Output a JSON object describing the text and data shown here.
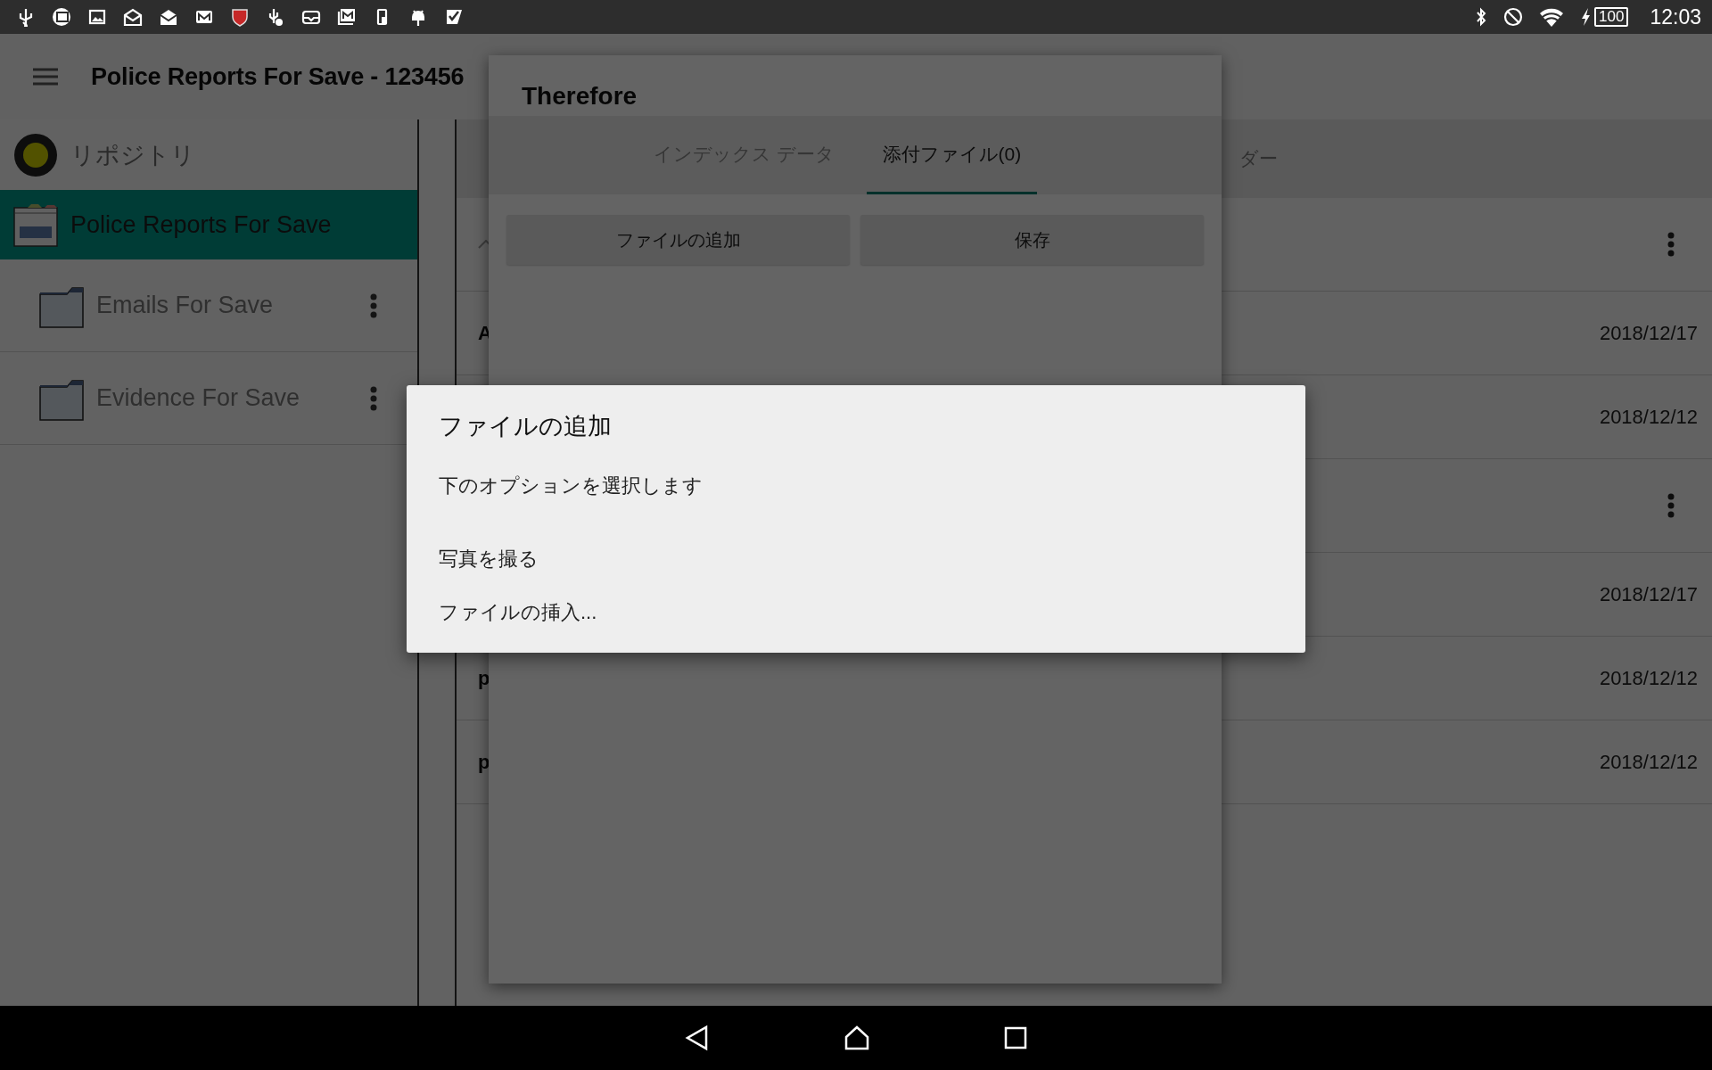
{
  "status_bar": {
    "battery": "100",
    "time": "12:03"
  },
  "app_bar": {
    "title": "Police Reports For Save - 123456"
  },
  "sidebar": {
    "repository": "リポジトリ",
    "items": [
      {
        "label": "Police Reports For Save",
        "selected": true,
        "kind": "cabinet"
      },
      {
        "label": "Emails For Save",
        "selected": false,
        "kind": "folder"
      },
      {
        "label": "Evidence For Save",
        "selected": false,
        "kind": "folder"
      }
    ]
  },
  "main": {
    "tab_partial": "ダー",
    "rows": [
      {
        "kind": "section"
      },
      {
        "kind": "document",
        "text": "A",
        "date": "2018/12/17"
      },
      {
        "kind": "document",
        "date": "2018/12/12"
      },
      {
        "kind": "group"
      },
      {
        "kind": "document",
        "date": "2018/12/17"
      },
      {
        "kind": "document",
        "text": "p",
        "date": "2018/12/12"
      },
      {
        "kind": "document",
        "text": "p",
        "date": "2018/12/12"
      }
    ]
  },
  "document_dialog": {
    "title": "Therefore",
    "tabs": [
      {
        "label": "インデックス データ",
        "selected": false
      },
      {
        "label": "添付ファイル(0)",
        "selected": true
      }
    ],
    "buttons": [
      "ファイルの追加",
      "保存"
    ]
  },
  "add_file_dialog": {
    "title": "ファイルの追加",
    "message": "下のオプションを選択します",
    "options": [
      "写真を撮る",
      "ファイルの挿入..."
    ]
  }
}
